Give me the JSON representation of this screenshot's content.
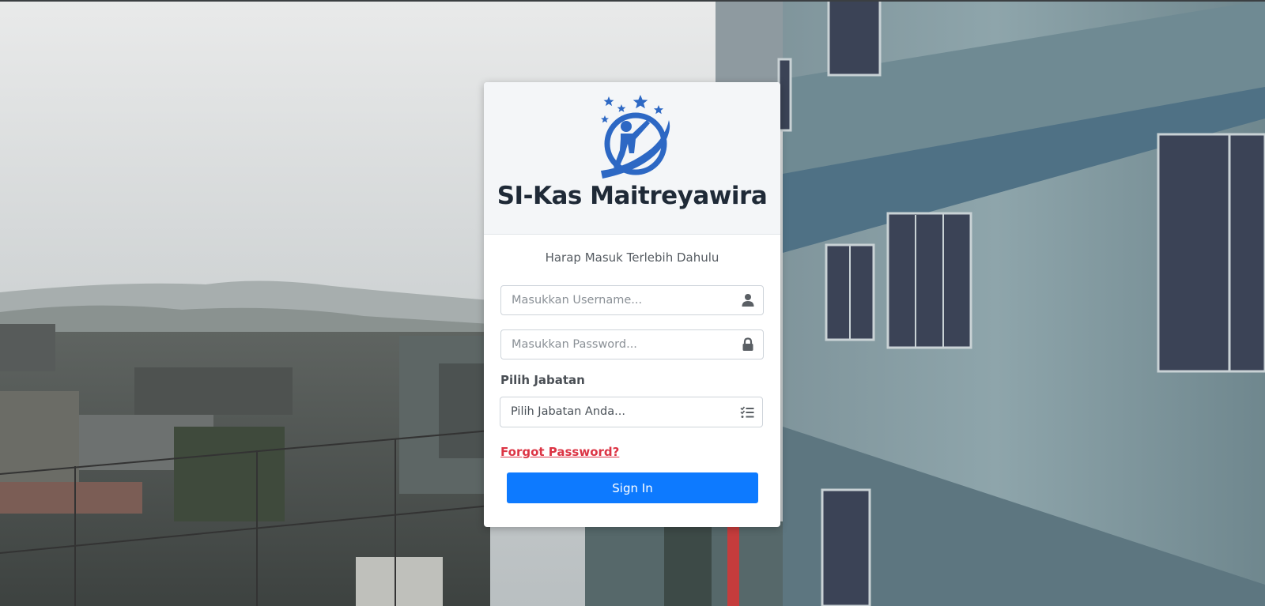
{
  "app": {
    "title": "SI-Kas Maitreyawira"
  },
  "login": {
    "subtitle": "Harap Masuk Terlebih Dahulu",
    "username_placeholder": "Masukkan Username...",
    "username_value": "",
    "password_placeholder": "Masukkan Password...",
    "password_value": "",
    "jabatan_label": "Pilih Jabatan",
    "jabatan_selected": "Pilih Jabatan Anda...",
    "forgot_label": "Forgot Password?",
    "signin_label": "Sign In"
  },
  "icons": {
    "username": "user-icon",
    "password": "lock-icon",
    "jabatan": "list-check-icon",
    "logo": "stars-person-globe-logo"
  },
  "colors": {
    "primary": "#0d7aff",
    "danger": "#dc3545",
    "logo_blue": "#2d68c4",
    "title": "#1f2a37"
  }
}
